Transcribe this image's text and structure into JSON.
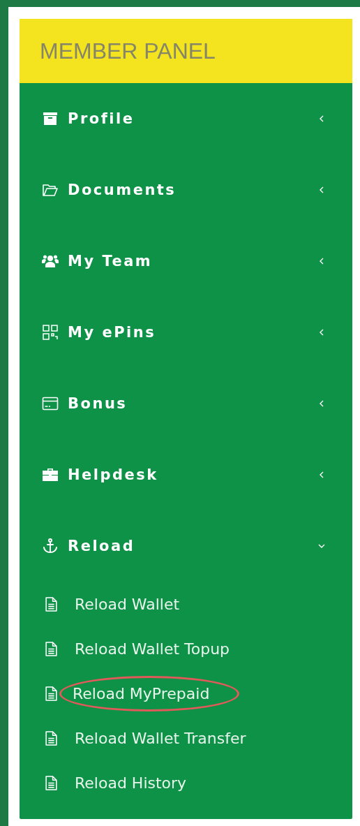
{
  "panel": {
    "title": "MEMBER PANEL"
  },
  "menu": [
    {
      "label": "Profile",
      "expanded": false
    },
    {
      "label": "Documents",
      "expanded": false
    },
    {
      "label": "My Team",
      "expanded": false
    },
    {
      "label": "My ePins",
      "expanded": false
    },
    {
      "label": "Bonus",
      "expanded": false
    },
    {
      "label": "Helpdesk",
      "expanded": false
    },
    {
      "label": "Reload",
      "expanded": true,
      "children": [
        {
          "label": "Reload Wallet",
          "circled": false
        },
        {
          "label": "Reload Wallet Topup",
          "circled": false
        },
        {
          "label": "Reload MyPrepaid",
          "circled": true
        },
        {
          "label": "Reload Wallet Transfer",
          "circled": false
        },
        {
          "label": "Reload History",
          "circled": false
        }
      ]
    }
  ]
}
